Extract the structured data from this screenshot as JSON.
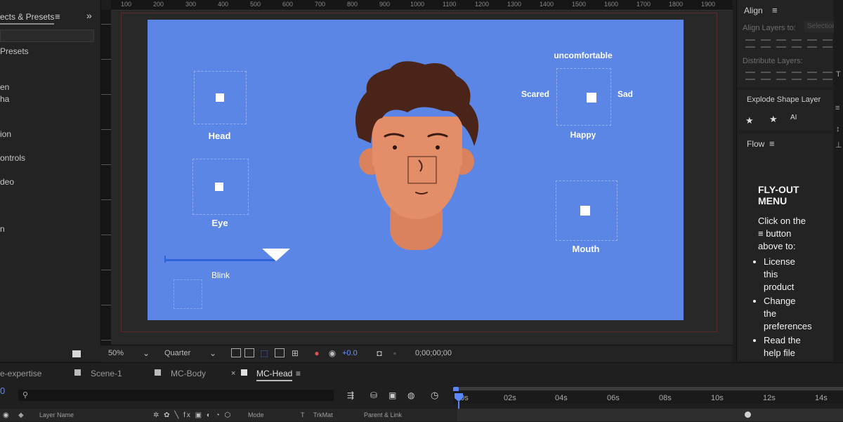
{
  "effects_panel": {
    "tab_label": "ects & Presets",
    "items": [
      "Presets",
      "en",
      "ha",
      "ion",
      "ontrols",
      "deo",
      "n"
    ]
  },
  "viewer": {
    "ruler_labels": [
      "100",
      "200",
      "300",
      "400",
      "500",
      "600",
      "700",
      "800",
      "900",
      "1000",
      "1100",
      "1200",
      "1300",
      "1400",
      "1500",
      "1600",
      "1700",
      "1800",
      "1900"
    ],
    "toolbar": {
      "zoom": "50%",
      "resolution": "Quarter",
      "exposure": "+0.0",
      "timecode": "0;00;00;00"
    }
  },
  "composition": {
    "background_color": "#5b86e6",
    "labels": {
      "head": "Head",
      "eye": "Eye",
      "blink": "Blink",
      "uncomfortable": "uncomfortable",
      "scared": "Scared",
      "sad": "Sad",
      "happy": "Happy",
      "mouth": "Mouth"
    }
  },
  "right_panels": {
    "align_title": "Align",
    "align_layers_to": "Align Layers to:",
    "align_layers_value": "Selection",
    "distribute_layers": "Distribute Layers:",
    "explode_title": "Explode Shape Layer",
    "explode_ai_label": "AI",
    "flow_title": "Flow",
    "flyout": {
      "heading": "FLY-OUT MENU",
      "intro": "Click on the ≡ button above to:",
      "items": [
        "License this product",
        "Change the preferences",
        "Read the help file"
      ]
    }
  },
  "timeline": {
    "tabs": [
      "e-expertise",
      "Scene-1",
      "MC-Body",
      "MC-Head"
    ],
    "active_tab": "MC-Head",
    "current_time": "0",
    "time_labels": [
      "00s",
      "02s",
      "04s",
      "06s",
      "08s",
      "10s",
      "12s",
      "14s"
    ],
    "columns": {
      "layer_name": "Layer Name",
      "mode": "Mode",
      "t": "T",
      "trkmat": "TrkMat",
      "parent_link": "Parent & Link"
    }
  }
}
